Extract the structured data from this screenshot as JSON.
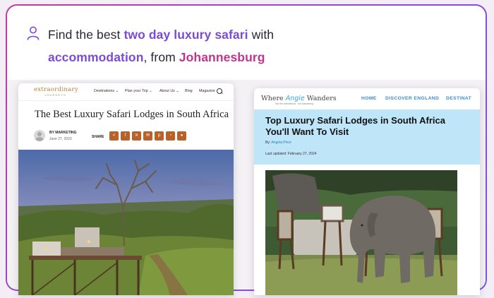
{
  "prompt": {
    "part1": "Find the best ",
    "highlight1": "two day luxury safari",
    "part2": " with",
    "highlight2": "accommodation",
    "part3": ", from ",
    "highlight3": "Johannesburg"
  },
  "colors": {
    "purple": "#7b4bd8",
    "pink": "#c2358e",
    "share_icon": "#b8612b",
    "angie_blue": "#3aa6de",
    "hero_blue": "#bfe5f9"
  },
  "card1": {
    "logo": "extraordinary",
    "logo_sub": "JOURNEYS",
    "menu": [
      "Destinations ⌄",
      "Plan your Trip ⌄",
      "About Us ⌄",
      "Blog",
      "Magazine"
    ],
    "title": "The Best Luxury Safari Lodges in South Africa",
    "author": "BY MARKETING",
    "date": "June 27, 2023",
    "share_label": "SHARE",
    "share_icons": [
      "share-icon",
      "facebook-icon",
      "x-icon",
      "email-icon",
      "pinterest-icon",
      "whatsapp-icon",
      "messenger-icon"
    ]
  },
  "card2": {
    "logo_where": "Where ",
    "logo_angie": "Angie",
    "logo_wanders": " Wanders",
    "logo_sub": "live the wanderlust · fun wandering",
    "menu": [
      "HOME",
      "DISCOVER ENGLAND",
      "DESTINAT"
    ],
    "title": "Top Luxury Safari Lodges in South Africa You'll Want To Visit",
    "by_prefix": "By: ",
    "author": "Angela Price",
    "updated": "Last updated: February 27, 2024"
  }
}
